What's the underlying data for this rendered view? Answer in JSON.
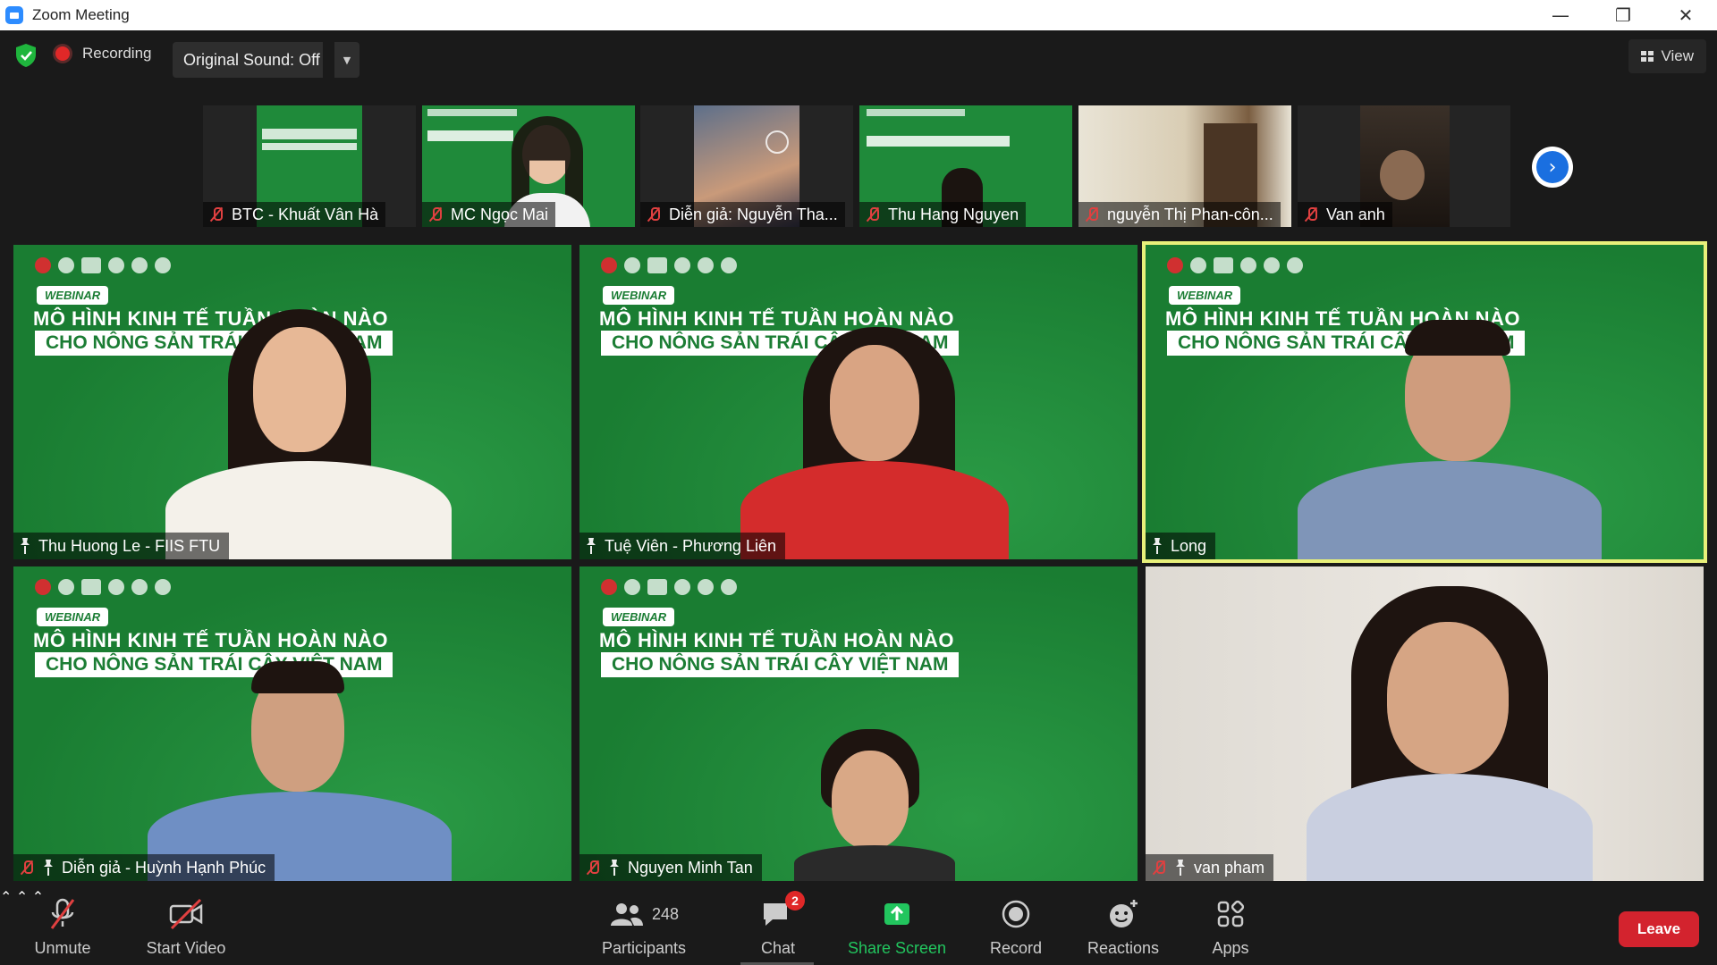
{
  "window": {
    "title": "Zoom Meeting",
    "minimize": "—",
    "restore": "❐",
    "close": "✕"
  },
  "topbar": {
    "recording_label": "Recording",
    "original_sound": "Original Sound: Off",
    "view_label": "View"
  },
  "filmstrip": [
    {
      "name": "BTC - Khuất Vân Hà"
    },
    {
      "name": "MC Ngọc Mai"
    },
    {
      "name": "Diễn giả: Nguyễn Tha..."
    },
    {
      "name": "Thu Hang Nguyen"
    },
    {
      "name": "nguyễn Thị Phan-côn..."
    },
    {
      "name": "Van anh"
    }
  ],
  "banner": {
    "webinar": "WEBINAR",
    "headline": "MÔ HÌNH KINH TẾ TUẦN HOÀN NÀO",
    "subline": "CHO NÔNG SẢN TRÁI CÂY VIỆT NAM"
  },
  "gallery": [
    {
      "name": "Thu Huong Le - FIIS FTU"
    },
    {
      "name": "Tuệ Viên - Phương Liên"
    },
    {
      "name": "Long"
    },
    {
      "name": "Diễn giả - Huỳnh Hạnh Phúc"
    },
    {
      "name": "Nguyen Minh Tan"
    },
    {
      "name": "van pham"
    }
  ],
  "toolbar": {
    "unmute": "Unmute",
    "start_video": "Start Video",
    "participants_count": "248",
    "participants": "Participants",
    "chat": "Chat",
    "chat_badge": "2",
    "share_screen": "Share Screen",
    "record": "Record",
    "reactions": "Reactions",
    "apps": "Apps",
    "leave": "Leave"
  },
  "colors": {
    "accent_blue": "#2d8cff",
    "leave_red": "#d3232e",
    "share_green": "#22c55e",
    "active_speaker": "#e8f07a",
    "banner_green": "#1f8a3a"
  }
}
